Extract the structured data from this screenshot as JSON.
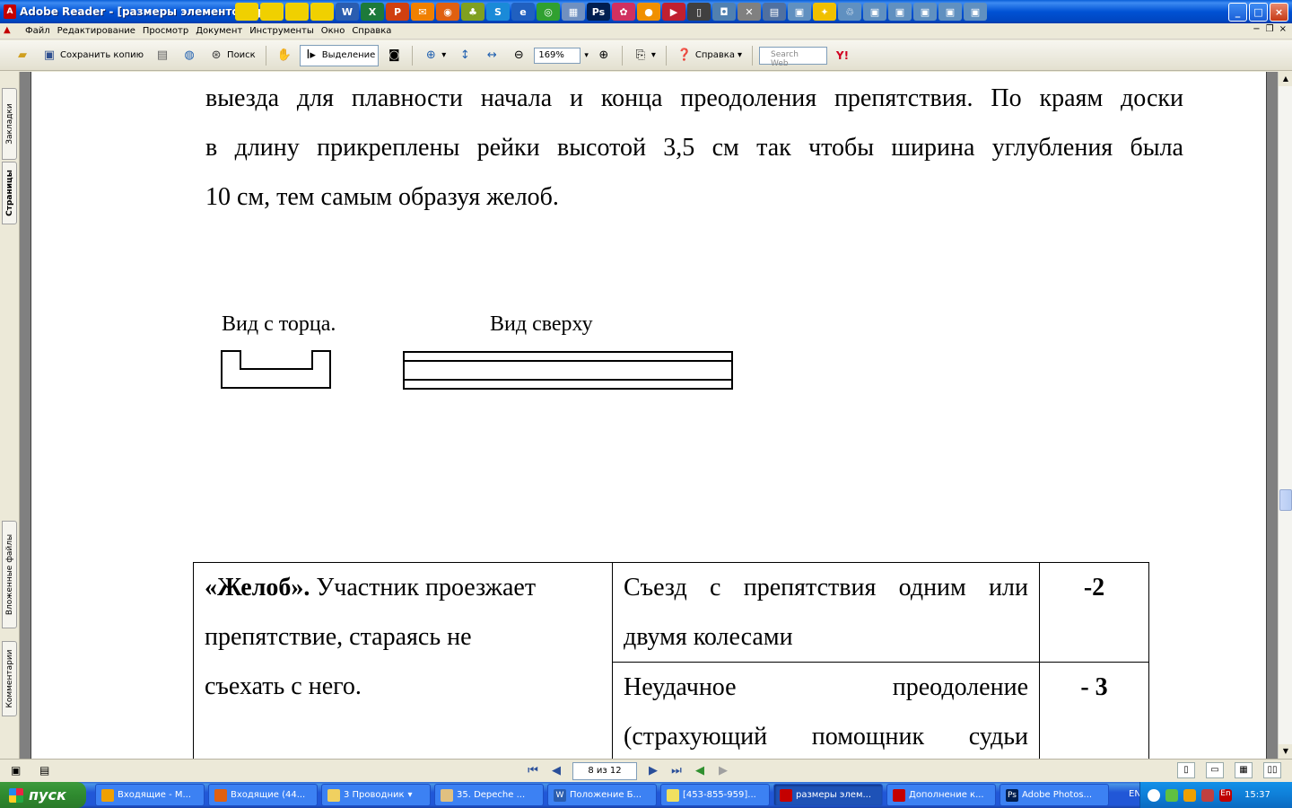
{
  "window": {
    "title": "Adobe Reader - [размеры элементов пр",
    "app_icon": "adobe-reader-icon",
    "minimize": "_",
    "maximize": "□",
    "close": "×"
  },
  "menu": {
    "items": [
      "Файл",
      "Редактирование",
      "Просмотр",
      "Документ",
      "Инструменты",
      "Окно",
      "Справка"
    ]
  },
  "toolbar": {
    "save_copy": "Сохранить копию",
    "search": "Поиск",
    "select": "Выделение",
    "zoom_value": "169%",
    "help": "Справка",
    "search_web_placeholder": "Search Web"
  },
  "leftnav": {
    "tabs": [
      "Закладки",
      "Страницы",
      "Вложенные файлы",
      "Комментарии"
    ]
  },
  "document": {
    "paragraph_lines": [
      "выезда для плавности начала и конца преодоления препятствия. По краям доски",
      "в длину прикреплены рейки высотой 3,5 см так чтобы ширина углубления была",
      "10 см, тем самым образуя желоб."
    ],
    "label_end_view": "Вид с торца.",
    "label_top_view": "Вид сверху",
    "table": {
      "col1_bold": "«Желоб».",
      "col1_text": " Участник проезжает",
      "col1_line2": "препятствие, стараясь не",
      "col1_line3": "съехать с него.",
      "row1_desc_l1": "Съезд с препятствия одним или",
      "row1_desc_l2": "двумя колесами",
      "row1_penalty": "-2",
      "row2_desc_l1": "Неудачное преодоление",
      "row2_desc_l2": "(страхующий помощник судьи",
      "row2_penalty": "- 3"
    }
  },
  "statusbar": {
    "page_field": "8 из 12"
  },
  "taskbar": {
    "start": "пуск",
    "tasks": [
      "Входящие - M...",
      "Входящие (44...",
      "3 Проводник",
      "35. Depeche ...",
      "Положение Б...",
      "[453-855-959]...",
      "размеры элем...",
      "Дополнение к...",
      "Adobe Photos..."
    ],
    "lang": "EN",
    "clock": "15:37",
    "tray_lang": "En"
  }
}
